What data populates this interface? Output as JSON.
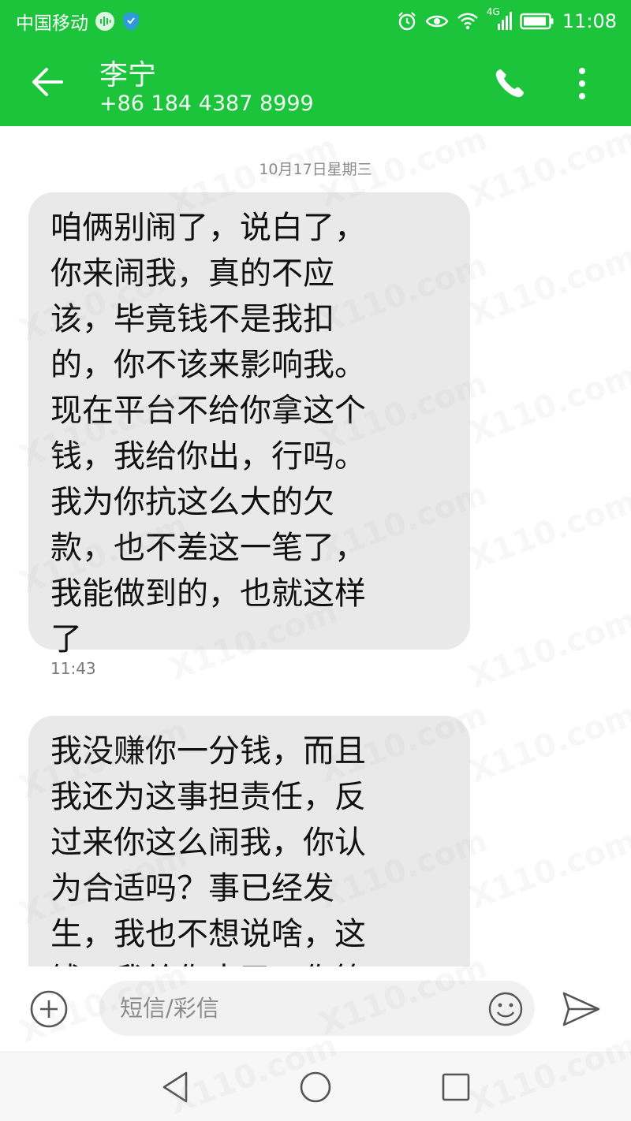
{
  "status_bar": {
    "carrier": "中国移动",
    "network": "4G",
    "time": "11:08"
  },
  "header": {
    "contact_name": "李宁",
    "contact_number": "+86 184 4387 8999",
    "back_icon": "arrow-left-icon",
    "call_icon": "phone-icon",
    "more_icon": "more-vertical-icon"
  },
  "conversation": {
    "date_divider": "10月17日星期三",
    "messages": [
      {
        "text": "咱俩别闹了，说白了，\n你来闹我，真的不应\n该，毕竟钱不是我扣\n的，你不该来影响我。\n现在平台不给你拿这个\n钱，我给你出，行吗。\n我为你抗这么大的欠\n款，也不差这一笔了，\n我能做到的，也就这样\n了",
        "time": "11:43"
      },
      {
        "text": "我没赚你一分钱，而且\n我还为这事担责任，反\n过来你这么闹我，你认\n为合适吗？事已经发\n生，我也不想说啥，这\n钱，我给你出了，你等"
      }
    ]
  },
  "composer": {
    "placeholder": "短信/彩信",
    "add_icon": "plus-circle-icon",
    "emoji_icon": "smiley-icon",
    "send_icon": "send-icon"
  },
  "watermark": "X110.com",
  "colors": {
    "header_green": "#1bc43a",
    "bubble_gray": "#e9e9ea"
  }
}
